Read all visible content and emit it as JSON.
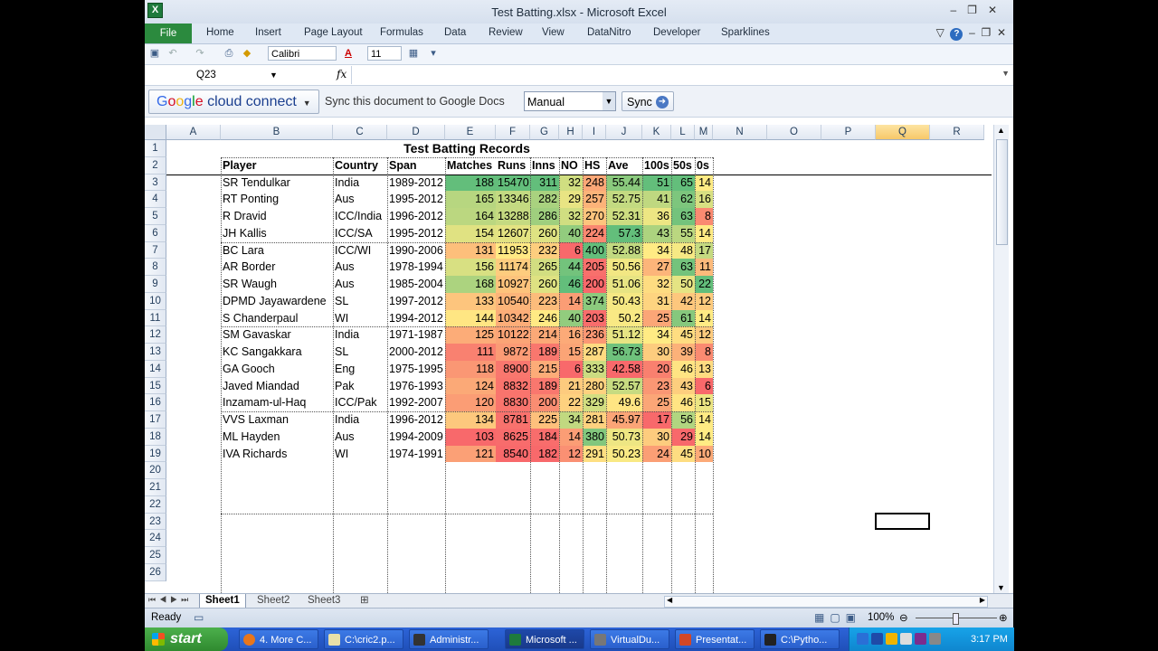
{
  "window": {
    "title": "Test Batting.xlsx - Microsoft Excel",
    "app_icon_letter": "X"
  },
  "ribbon": {
    "file": "File",
    "tabs": [
      "Home",
      "Insert",
      "Page Layout",
      "Formulas",
      "Data",
      "Review",
      "View",
      "DataNitro",
      "Developer",
      "Sparklines"
    ]
  },
  "toolbar": {
    "font_name": "Calibri",
    "font_size": "11"
  },
  "formula_bar": {
    "name_box": "Q23",
    "fx": "fx",
    "content": ""
  },
  "google_bar": {
    "brand": [
      "G",
      "o",
      "o",
      "g",
      "l",
      "e"
    ],
    "brand_suffix": " cloud connect",
    "sync_text": "Sync this document to Google Docs",
    "mode": "Manual",
    "sync_button": "Sync"
  },
  "columns": [
    "A",
    "B",
    "C",
    "D",
    "E",
    "F",
    "G",
    "H",
    "I",
    "J",
    "K",
    "L",
    "M",
    "N",
    "O",
    "P",
    "Q",
    "R"
  ],
  "selected_column": "Q",
  "rows": [
    "1",
    "2",
    "3",
    "4",
    "5",
    "6",
    "7",
    "8",
    "9",
    "10",
    "11",
    "12",
    "13",
    "14",
    "15",
    "16",
    "17",
    "18",
    "19",
    "20",
    "21",
    "22",
    "23",
    "24",
    "25",
    "26"
  ],
  "sheet": {
    "title": "Test Batting Records",
    "headers": [
      "Player",
      "Country",
      "Span",
      "Matches",
      "Runs",
      "Inns",
      "NO",
      "HS",
      "Ave",
      "100s",
      "50s",
      "0s"
    ],
    "records": [
      [
        "SR Tendulkar",
        "India",
        "1989-2012",
        "188",
        "15470",
        "311",
        "32",
        "248",
        "55.44",
        "51",
        "65",
        "14"
      ],
      [
        "RT Ponting",
        "Aus",
        "1995-2012",
        "165",
        "13346",
        "282",
        "29",
        "257",
        "52.75",
        "41",
        "62",
        "16"
      ],
      [
        "R Dravid",
        "ICC/India",
        "1996-2012",
        "164",
        "13288",
        "286",
        "32",
        "270",
        "52.31",
        "36",
        "63",
        "8"
      ],
      [
        "JH Kallis",
        "ICC/SA",
        "1995-2012",
        "154",
        "12607",
        "260",
        "40",
        "224",
        "57.3",
        "43",
        "55",
        "14"
      ],
      [
        "BC Lara",
        "ICC/WI",
        "1990-2006",
        "131",
        "11953",
        "232",
        "6",
        "400",
        "52.88",
        "34",
        "48",
        "17"
      ],
      [
        "AR Border",
        "Aus",
        "1978-1994",
        "156",
        "11174",
        "265",
        "44",
        "205",
        "50.56",
        "27",
        "63",
        "11"
      ],
      [
        "SR Waugh",
        "Aus",
        "1985-2004",
        "168",
        "10927",
        "260",
        "46",
        "200",
        "51.06",
        "32",
        "50",
        "22"
      ],
      [
        "DPMD Jayawardene",
        "SL",
        "1997-2012",
        "133",
        "10540",
        "223",
        "14",
        "374",
        "50.43",
        "31",
        "42",
        "12"
      ],
      [
        "S Chanderpaul",
        "WI",
        "1994-2012",
        "144",
        "10342",
        "246",
        "40",
        "203",
        "50.2",
        "25",
        "61",
        "14"
      ],
      [
        "SM Gavaskar",
        "India",
        "1971-1987",
        "125",
        "10122",
        "214",
        "16",
        "236",
        "51.12",
        "34",
        "45",
        "12"
      ],
      [
        "KC Sangakkara",
        "SL",
        "2000-2012",
        "111",
        "9872",
        "189",
        "15",
        "287",
        "56.73",
        "30",
        "39",
        "8"
      ],
      [
        "GA Gooch",
        "Eng",
        "1975-1995",
        "118",
        "8900",
        "215",
        "6",
        "333",
        "42.58",
        "20",
        "46",
        "13"
      ],
      [
        "Javed Miandad",
        "Pak",
        "1976-1993",
        "124",
        "8832",
        "189",
        "21",
        "280",
        "52.57",
        "23",
        "43",
        "6"
      ],
      [
        "Inzamam-ul-Haq",
        "ICC/Pak",
        "1992-2007",
        "120",
        "8830",
        "200",
        "22",
        "329",
        "49.6",
        "25",
        "46",
        "15"
      ],
      [
        "VVS Laxman",
        "India",
        "1996-2012",
        "134",
        "8781",
        "225",
        "34",
        "281",
        "45.97",
        "17",
        "56",
        "14"
      ],
      [
        "ML Hayden",
        "Aus",
        "1994-2009",
        "103",
        "8625",
        "184",
        "14",
        "380",
        "50.73",
        "30",
        "29",
        "14"
      ],
      [
        "IVA Richards",
        "WI",
        "1974-1991",
        "121",
        "8540",
        "182",
        "12",
        "291",
        "50.23",
        "24",
        "45",
        "10"
      ]
    ]
  },
  "sheet_tabs": [
    "Sheet1",
    "Sheet2",
    "Sheet3"
  ],
  "status": {
    "text": "Ready",
    "zoom": "100%"
  },
  "taskbar": {
    "start": "start",
    "items": [
      "4. More C...",
      "C:\\cric2.p...",
      "Administr...",
      "Microsoft ...",
      "VirtualDu...",
      "Presentat...",
      "C:\\Pytho..."
    ],
    "clock": "3:17 PM"
  }
}
